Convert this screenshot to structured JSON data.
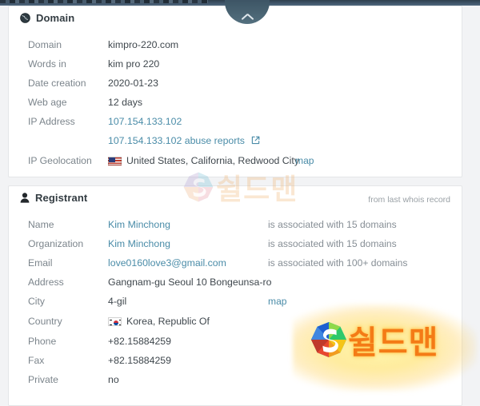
{
  "window": {
    "collapse_tab_icon": "chevron-up-icon"
  },
  "domain_card": {
    "icon": "globe-icon",
    "title": "Domain",
    "rows": [
      {
        "label": "Domain",
        "value": "kimpro-220.com"
      },
      {
        "label": "Words in",
        "value": "kim pro 220"
      },
      {
        "label": "Date creation",
        "value": "2020-01-23"
      },
      {
        "label": "Web age",
        "value": "12 days"
      },
      {
        "label": "IP Address",
        "value": "107.154.133.102"
      },
      {
        "label": "",
        "value": "107.154.133.102 abuse reports",
        "icon": "external-link-icon"
      },
      {
        "label": "IP Geolocation",
        "value": "United States, California, Redwood City",
        "flag": "us-flag-icon",
        "map_label": "map"
      }
    ]
  },
  "registrant_card": {
    "icon": "person-icon",
    "title": "Registrant",
    "note": "from last whois record",
    "rows": [
      {
        "label": "Name",
        "value": "Kim Minchong",
        "aux": "is associated with 15 domains"
      },
      {
        "label": "Organization",
        "value": "Kim Minchong",
        "aux": "is associated with 15 domains"
      },
      {
        "label": "Email",
        "value": "love0160love3@gmail.com",
        "aux": "is associated with 100+ domains"
      },
      {
        "label": "Address",
        "value": "Gangnam-gu Seoul 10 Bongeunsa-ro"
      },
      {
        "label": "City",
        "value": "4-gil",
        "map_label": "map"
      },
      {
        "label": "Country",
        "value": "Korea, Republic Of",
        "flag": "kr-flag-icon"
      },
      {
        "label": "Phone",
        "value": "+82.15884259"
      },
      {
        "label": "Fax",
        "value": "+82.15884259"
      },
      {
        "label": "Private",
        "value": "no"
      }
    ]
  },
  "watermarks": {
    "center": {
      "text": "쉴드맨",
      "logo": "shieldman-s-logo"
    },
    "corner": {
      "text": "쉴드맨",
      "logo": "shieldman-s-logo"
    }
  },
  "colors": {
    "link": "#4a8ca8",
    "label": "#7c858c",
    "value": "#3f474d",
    "chrome": "#3c5064",
    "watermark_orange": "#f47b16"
  }
}
